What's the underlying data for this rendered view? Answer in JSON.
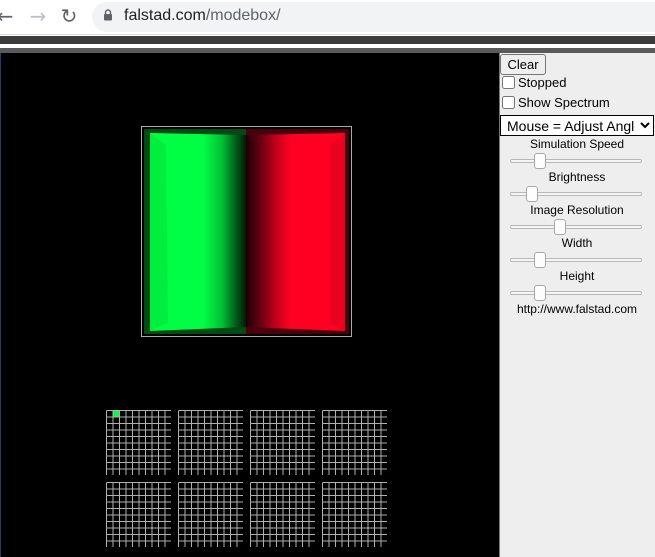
{
  "browser": {
    "url_host": "falstad.com",
    "url_path": "/modebox/",
    "icons": [
      "back-arrow-icon",
      "forward-arrow-icon",
      "reload-icon",
      "lock-icon"
    ]
  },
  "panel": {
    "clear_label": "Clear",
    "stopped_label": "Stopped",
    "stopped_checked": false,
    "show_spectrum_label": "Show Spectrum",
    "show_spectrum_checked": false,
    "mouse_mode": "Mouse = Adjust Angle",
    "sliders": [
      {
        "label": "Simulation Speed",
        "level": 0.2
      },
      {
        "label": "Brightness",
        "level": 0.13
      },
      {
        "label": "Image Resolution",
        "level": 0.37
      },
      {
        "label": "Width",
        "level": 0.2
      },
      {
        "label": "Height",
        "level": 0.2
      }
    ],
    "footer_url": "http://www.falstad.com"
  },
  "mode_selector": {
    "rows": 2,
    "cols": 4,
    "cells_per_side": 10,
    "selected": {
      "grid": 0,
      "col": 1,
      "row": 0
    },
    "selected_color": "#00ff44"
  },
  "colors": {
    "positive": "#00ff44",
    "negative": "#ff0022",
    "background": "#000000"
  }
}
